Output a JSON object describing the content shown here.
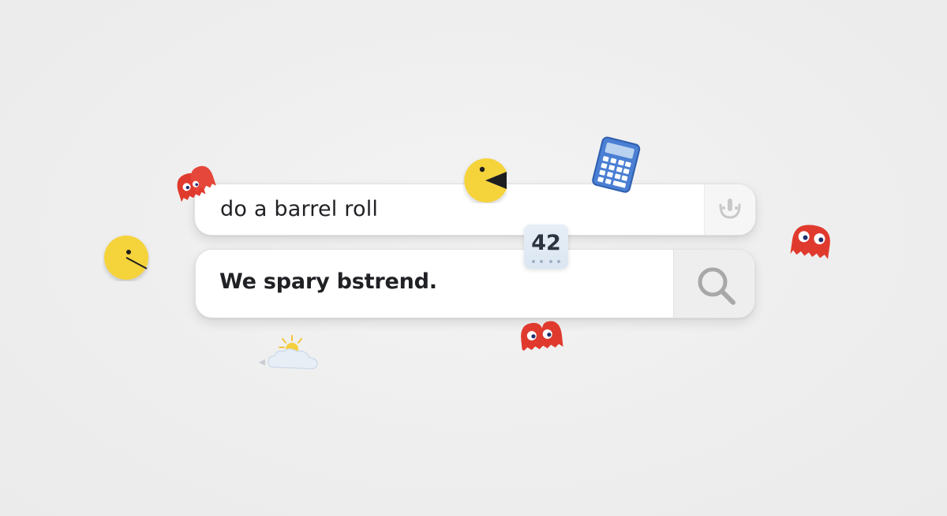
{
  "search": {
    "suggestion_text": "do a barrel roll",
    "query_text": "We spary bstrend."
  },
  "badge": {
    "number": "42"
  },
  "icons": {
    "mic": "mic-icon",
    "search": "magnifier-icon",
    "calculator": "calculator-icon",
    "weather": "partly-cloudy-icon",
    "pacman": "pacman-icon",
    "ghost": "ghost-icon"
  },
  "colors": {
    "background": "#efefef",
    "pacman_yellow": "#f5d33a",
    "ghost_red": "#e03a2e",
    "calculator_blue": "#4a7fd4",
    "text": "#202124"
  }
}
